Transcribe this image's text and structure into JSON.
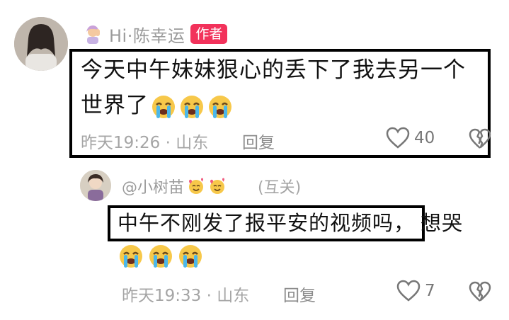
{
  "main_comment": {
    "author": "Hi·陈幸运",
    "badge": "作者",
    "text": "今天中午妹妹狠心的丢下了我去另一个世界了",
    "emoji_count": 3,
    "meta": "昨天19:26 · 山东",
    "reply_label": "回复",
    "likes": "40",
    "icons": [
      "avatar",
      "author-emoji",
      "loudly-crying-face-icon",
      "heart-outline-icon",
      "broken-heart-icon"
    ]
  },
  "reply_comment": {
    "author": "@小树苗",
    "relation": "(互关)",
    "text_boxed": "中午不刚发了报平安的视频吗，",
    "text_rest": "想哭",
    "emoji_count": 3,
    "meta": "昨天19:33 · 山东",
    "reply_label": "回复",
    "likes": "7",
    "icons": [
      "avatar",
      "smiling-face-with-hearts-icon",
      "loudly-crying-face-icon",
      "heart-outline-icon",
      "broken-heart-icon"
    ]
  },
  "colors": {
    "badge": "#f2325b",
    "muted_text": "#a5a5a5",
    "emoji_yellow": "#f7c84a",
    "emoji_tears": "#4cb7e9"
  }
}
